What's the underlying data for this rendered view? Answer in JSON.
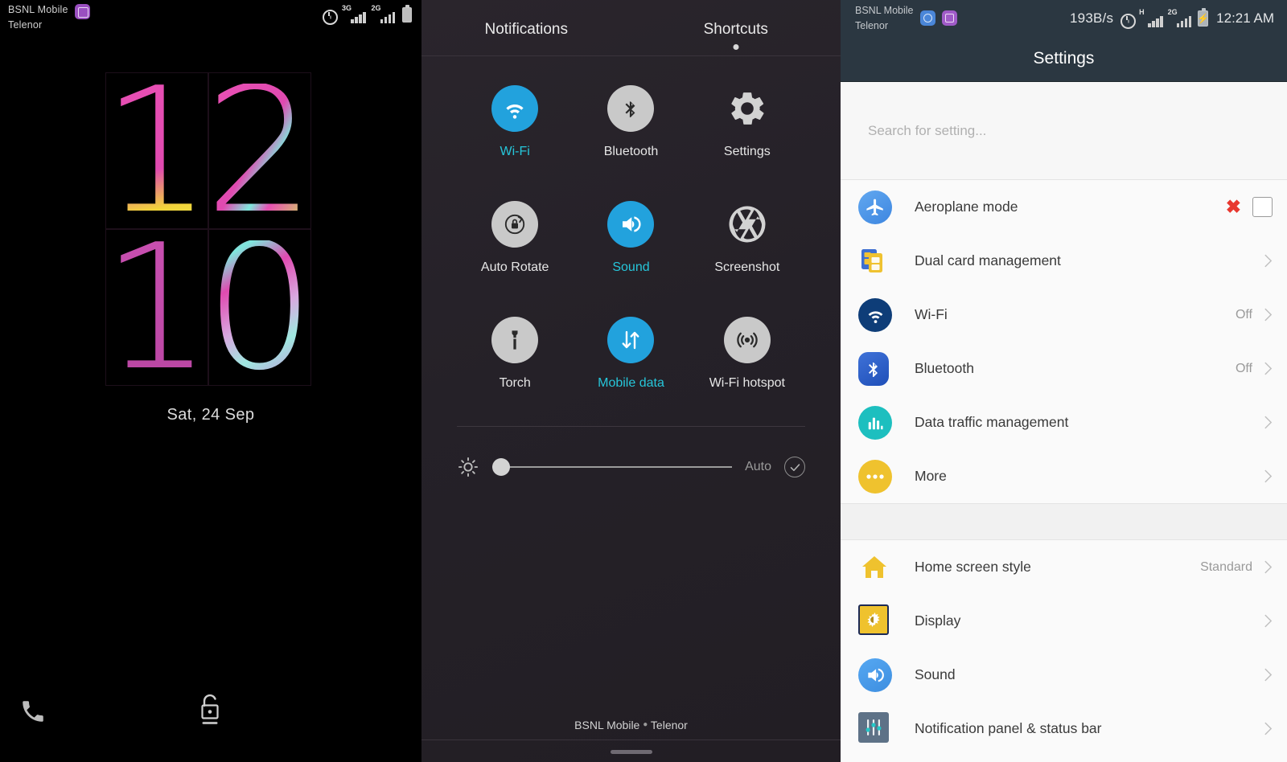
{
  "lock_screen": {
    "status_bar": {
      "carrier_line1": "BSNL Mobile",
      "carrier_line2": "Telenor",
      "badge_icon": "screenshot-badge-icon",
      "alarm_icon": "alarm-icon",
      "signal1_label": "3G",
      "signal2_label": "2G",
      "battery_icon": "battery-icon"
    },
    "clock": {
      "digit1": "1",
      "digit2": "2",
      "digit3": "1",
      "digit4": "0",
      "hour": "12",
      "minute": "10"
    },
    "date": "Sat, 24 Sep",
    "phone_shortcut": "phone-icon",
    "unlock_shortcut": "unlock-icon"
  },
  "quick_settings": {
    "tabs": [
      {
        "label": "Notifications",
        "active": false
      },
      {
        "label": "Shortcuts",
        "active": true
      }
    ],
    "tiles": [
      {
        "label": "Wi-Fi",
        "icon": "wifi-icon",
        "state": "on",
        "style": "filled"
      },
      {
        "label": "Bluetooth",
        "icon": "bluetooth-icon",
        "state": "off",
        "style": "filled"
      },
      {
        "label": "Settings",
        "icon": "gear-icon",
        "state": "off",
        "style": "bare"
      },
      {
        "label": "Auto Rotate",
        "icon": "rotation-lock-icon",
        "state": "off",
        "style": "filled"
      },
      {
        "label": "Sound",
        "icon": "speaker-icon",
        "state": "on",
        "style": "filled"
      },
      {
        "label": "Screenshot",
        "icon": "aperture-icon",
        "state": "off",
        "style": "bare"
      },
      {
        "label": "Torch",
        "icon": "flashlight-icon",
        "state": "off",
        "style": "filled"
      },
      {
        "label": "Mobile data",
        "icon": "data-arrows-icon",
        "state": "on",
        "style": "filled"
      },
      {
        "label": "Wi-Fi hotspot",
        "icon": "hotspot-icon",
        "state": "off",
        "style": "filled"
      }
    ],
    "brightness": {
      "icon": "brightness-icon",
      "value_percent": 0,
      "auto_label": "Auto",
      "auto_checked": true,
      "auto_icon": "check-circle-icon"
    },
    "footer_carrier": "BSNL Mobile",
    "footer_carrier2": "Telenor",
    "footer_separator": "●",
    "handle": "drag-handle"
  },
  "settings": {
    "status_bar": {
      "carrier_line1": "BSNL Mobile",
      "carrier_line2": "Telenor",
      "badge1_icon": "sync-badge-icon",
      "badge2_icon": "screenshot-badge-icon",
      "net_speed": "193B/s",
      "alarm_icon": "alarm-icon",
      "signal1_label": "H",
      "signal2_label": "2G",
      "battery_icon": "battery-charging-icon",
      "time": "12:21 AM"
    },
    "title": "Settings",
    "search": {
      "placeholder": "Search for setting...",
      "value": ""
    },
    "groups": [
      {
        "rows": [
          {
            "label": "Aeroplane mode",
            "icon": "aeroplane-icon",
            "value": "",
            "control": "checkbox",
            "marker": "✖",
            "checked": false
          },
          {
            "label": "Dual card management",
            "icon": "dual-sim-icon",
            "value": "",
            "control": "chevron"
          },
          {
            "label": "Wi-Fi",
            "icon": "wifi-icon",
            "value": "Off",
            "control": "chevron"
          },
          {
            "label": "Bluetooth",
            "icon": "bluetooth-icon",
            "value": "Off",
            "control": "chevron"
          },
          {
            "label": "Data traffic management",
            "icon": "bar-chart-icon",
            "value": "",
            "control": "chevron"
          },
          {
            "label": "More",
            "icon": "more-dots-icon",
            "value": "",
            "control": "chevron"
          }
        ]
      },
      {
        "rows": [
          {
            "label": "Home screen style",
            "icon": "home-icon",
            "value": "Standard",
            "control": "chevron"
          },
          {
            "label": "Display",
            "icon": "display-icon",
            "value": "",
            "control": "chevron"
          },
          {
            "label": "Sound",
            "icon": "speaker-icon",
            "value": "",
            "control": "chevron"
          },
          {
            "label": "Notification panel & status bar",
            "icon": "sliders-icon",
            "value": "",
            "control": "chevron"
          }
        ]
      }
    ]
  },
  "colors": {
    "accent_blue": "#22a2dd",
    "accent_cyan": "#26c6da",
    "header_navy": "#2b3741",
    "danger_red": "#e8382f",
    "panel_dark": "#252128"
  }
}
